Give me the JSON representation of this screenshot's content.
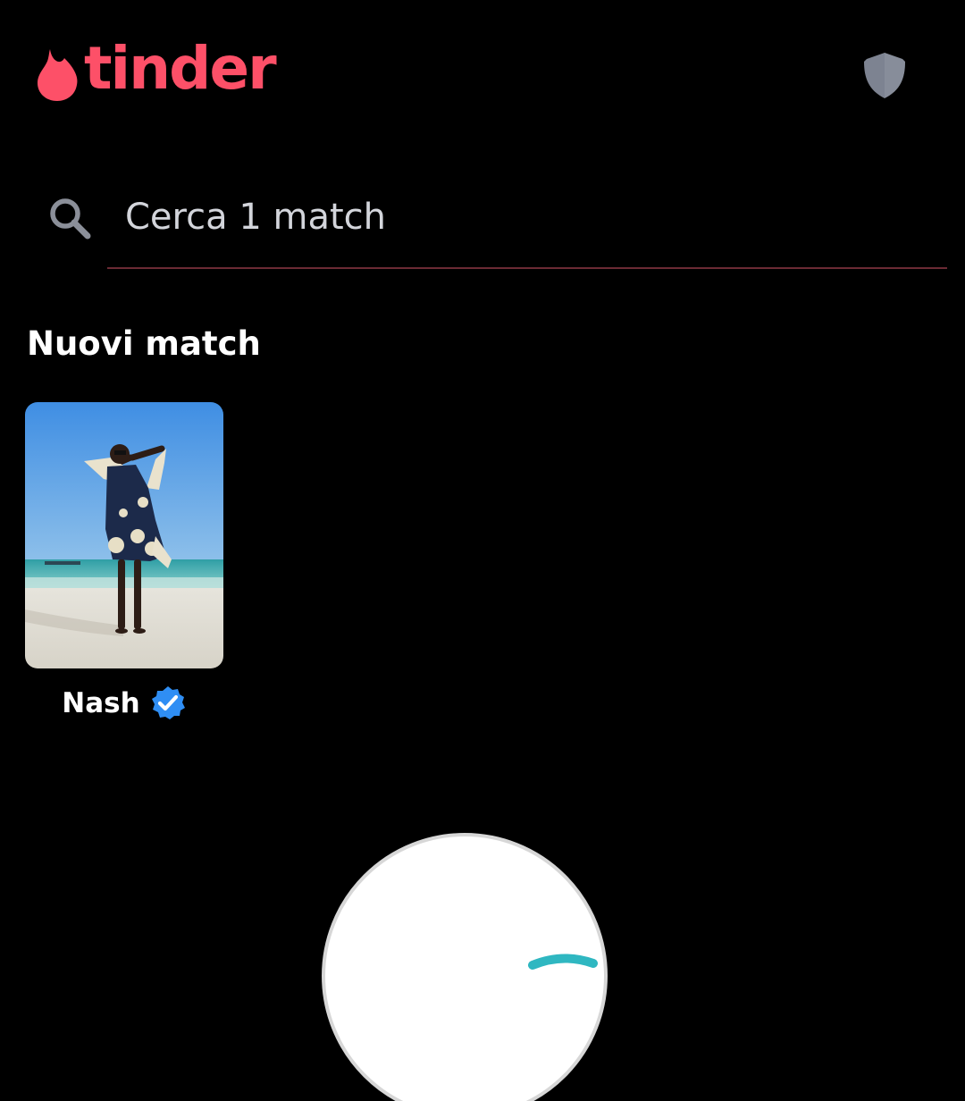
{
  "header": {
    "logo_text": "tinder",
    "brand_color": "#fd5068",
    "shield_icon": "shield-icon",
    "shield_color": "#7d8391"
  },
  "search": {
    "placeholder": "Cerca 1 match",
    "value": "",
    "icon": "search-icon",
    "underline_color": "#6b2a34"
  },
  "new_matches": {
    "title": "Nuovi match",
    "items": [
      {
        "name": "Nash",
        "verified": true,
        "verified_color": "#2f8ef4"
      }
    ]
  }
}
